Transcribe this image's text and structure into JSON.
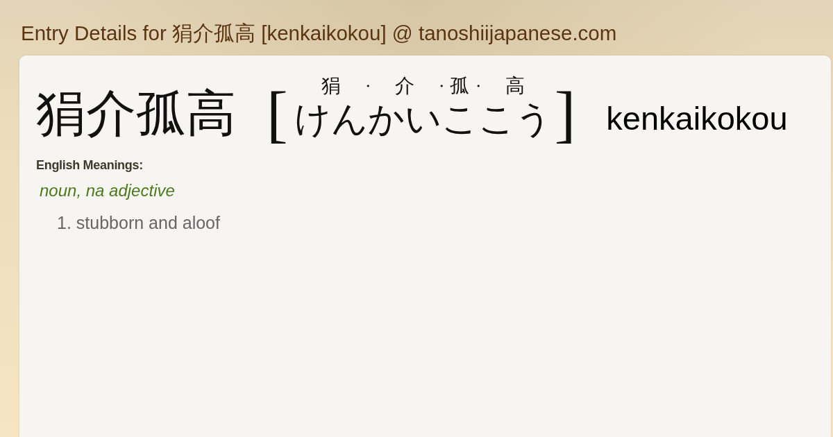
{
  "page_title": "Entry Details for 狷介孤高 [kenkaikokou] @ tanoshiijapanese.com",
  "entry": {
    "kanji": "狷介孤高",
    "bracket_open": "[",
    "reading": [
      {
        "kind": "segment",
        "ruby": "狷",
        "kana": "けん"
      },
      {
        "kind": "dot",
        "text": "・"
      },
      {
        "kind": "segment",
        "ruby": "介",
        "kana": "かい"
      },
      {
        "kind": "dot",
        "text": "・"
      },
      {
        "kind": "segment",
        "ruby": "孤",
        "kana": "こ"
      },
      {
        "kind": "dot",
        "text": "・"
      },
      {
        "kind": "segment",
        "ruby": "高",
        "kana": "こう"
      }
    ],
    "bracket_close": "]",
    "romaji": "kenkaikokou"
  },
  "meanings": {
    "heading": "English Meanings:",
    "part_of_speech": "noun, na adjective",
    "items": [
      {
        "number": "1.",
        "text": "stubborn and aloof"
      }
    ]
  }
}
